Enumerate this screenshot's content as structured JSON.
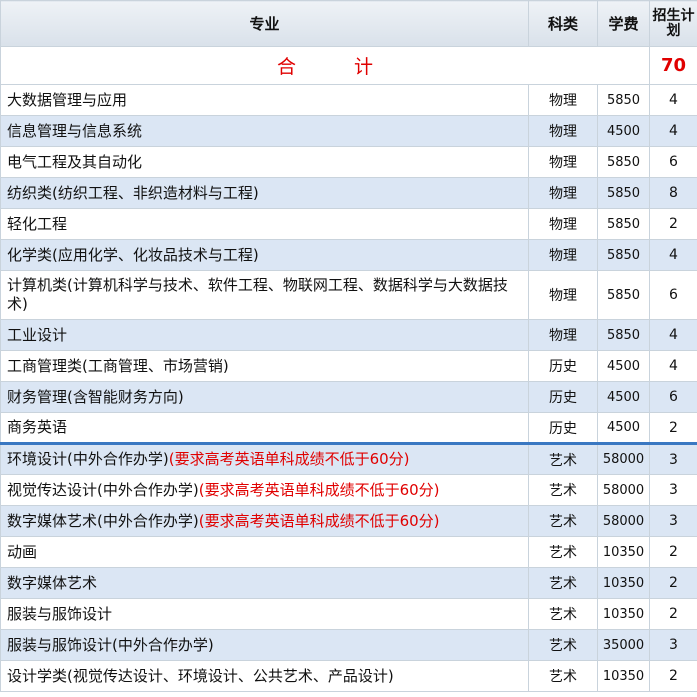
{
  "header": {
    "major": "专业",
    "category": "科类",
    "fee": "学费",
    "plan": "招生计划"
  },
  "total": {
    "label_a": "合",
    "label_b": "计",
    "plan": "70"
  },
  "rows": [
    {
      "major": "大数据管理与应用",
      "note": "",
      "category": "物理",
      "fee": "5850",
      "plan": "4"
    },
    {
      "major": "信息管理与信息系统",
      "note": "",
      "category": "物理",
      "fee": "4500",
      "plan": "4"
    },
    {
      "major": "电气工程及其自动化",
      "note": "",
      "category": "物理",
      "fee": "5850",
      "plan": "6"
    },
    {
      "major": "纺织类(纺织工程、非织造材料与工程)",
      "note": "",
      "category": "物理",
      "fee": "5850",
      "plan": "8"
    },
    {
      "major": "轻化工程",
      "note": "",
      "category": "物理",
      "fee": "5850",
      "plan": "2"
    },
    {
      "major": "化学类(应用化学、化妆品技术与工程)",
      "note": "",
      "category": "物理",
      "fee": "5850",
      "plan": "4"
    },
    {
      "major": "计算机类(计算机科学与技术、软件工程、物联网工程、数据科学与大数据技术)",
      "note": "",
      "category": "物理",
      "fee": "5850",
      "plan": "6"
    },
    {
      "major": "工业设计",
      "note": "",
      "category": "物理",
      "fee": "5850",
      "plan": "4"
    },
    {
      "major": "工商管理类(工商管理、市场营销)",
      "note": "",
      "category": "历史",
      "fee": "4500",
      "plan": "4"
    },
    {
      "major": "财务管理(含智能财务方向)",
      "note": "",
      "category": "历史",
      "fee": "4500",
      "plan": "6"
    },
    {
      "major": "商务英语",
      "note": "",
      "category": "历史",
      "fee": "4500",
      "plan": "2"
    },
    {
      "major": "环境设计(中外合作办学)",
      "note": "(要求高考英语单科成绩不低于60分)",
      "category": "艺术",
      "fee": "58000",
      "plan": "3"
    },
    {
      "major": "视觉传达设计(中外合作办学)",
      "note": "(要求高考英语单科成绩不低于60分)",
      "category": "艺术",
      "fee": "58000",
      "plan": "3"
    },
    {
      "major": "数字媒体艺术(中外合作办学)",
      "note": "(要求高考英语单科成绩不低于60分)",
      "category": "艺术",
      "fee": "58000",
      "plan": "3"
    },
    {
      "major": "动画",
      "note": "",
      "category": "艺术",
      "fee": "10350",
      "plan": "2"
    },
    {
      "major": "数字媒体艺术",
      "note": "",
      "category": "艺术",
      "fee": "10350",
      "plan": "2"
    },
    {
      "major": "服装与服饰设计",
      "note": "",
      "category": "艺术",
      "fee": "10350",
      "plan": "2"
    },
    {
      "major": "服装与服饰设计(中外合作办学)",
      "note": "",
      "category": "艺术",
      "fee": "35000",
      "plan": "3"
    },
    {
      "major": "设计学类(视觉传达设计、环境设计、公共艺术、产品设计)",
      "note": "",
      "category": "艺术",
      "fee": "10350",
      "plan": "2"
    }
  ]
}
